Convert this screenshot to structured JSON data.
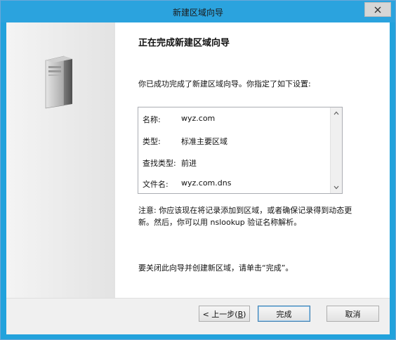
{
  "window": {
    "title": "新建区域向导"
  },
  "content": {
    "heading": "正在完成新建区域向导",
    "description": "你已成功完成了新建区域向导。你指定了如下设置:",
    "summary": [
      {
        "label": "名称:",
        "value": "wyz.com"
      },
      {
        "label": "类型:",
        "value": "标准主要区域"
      },
      {
        "label": "查找类型:",
        "value": "前进"
      },
      {
        "label": "文件名:",
        "value": "wyz.com.dns"
      }
    ],
    "note_line1": "注意: 你应该现在将记录添加到区域，或者确保记录得到动态更",
    "note_line2": "新。然后，你可以用 nslookup 验证名称解析。",
    "close_hint": "要关闭此向导并创建新区域，请单击“完成”。"
  },
  "buttons": {
    "back_prefix": "< 上一步(",
    "back_key": "B",
    "back_suffix": ")",
    "finish": "完成",
    "cancel": "取消"
  },
  "icons": {
    "close": "close-icon",
    "server": "server-icon",
    "scroll_up": "scroll-up-arrow-icon",
    "scroll_down": "scroll-down-arrow-icon"
  }
}
